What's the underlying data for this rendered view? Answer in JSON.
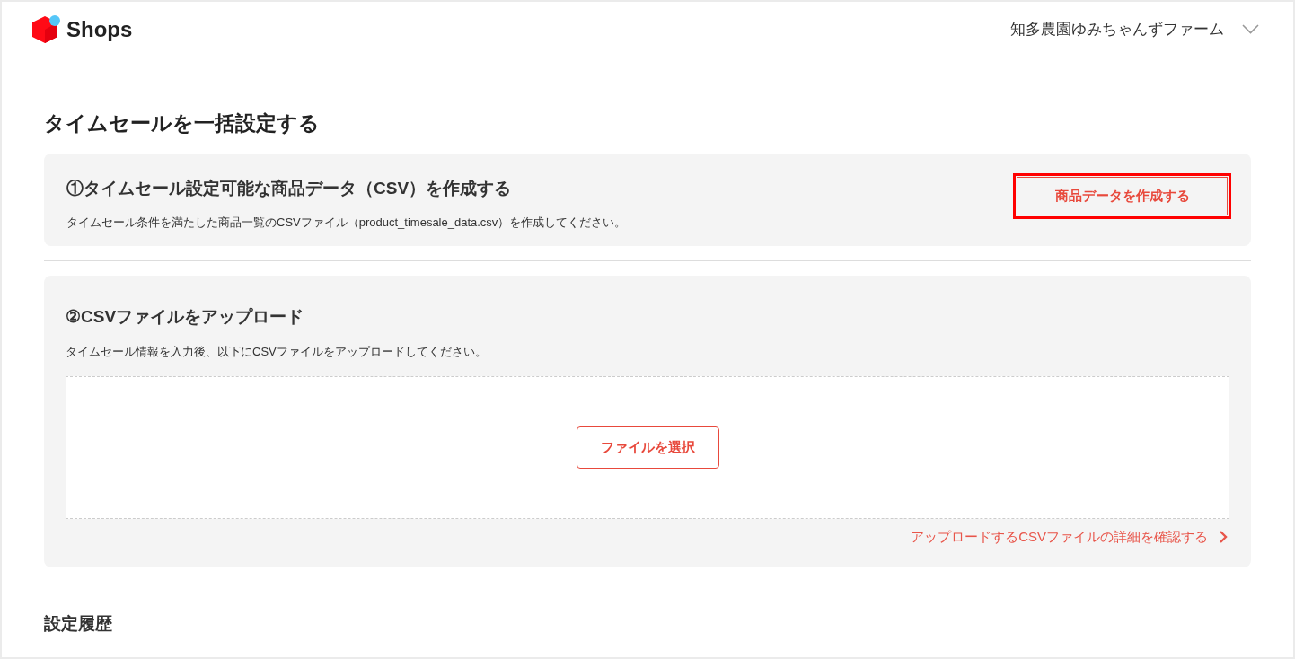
{
  "header": {
    "logo_text": "Shops",
    "shop_name": "知多農園ゆみちゃんずファーム"
  },
  "page_title": "タイムセールを一括設定する",
  "steps": [
    {
      "kind": "create",
      "title": "①タイムセール設定可能な商品データ（CSV）を作成する",
      "description": "タイムセール条件を満たした商品一覧のCSVファイル（product_timesale_data.csv）を作成してください。",
      "button": {
        "label": "商品データを作成する",
        "highlighted": true
      }
    },
    {
      "kind": "upload",
      "title": "②CSVファイルをアップロード",
      "description": "タイムセール情報を入力後、以下にCSVファイルをアップロードしてください。",
      "button": {
        "label": "ファイルを選択",
        "highlighted": false
      },
      "link": "アップロードするCSVファイルの詳細を確認する"
    }
  ],
  "history": {
    "title": "設定履歴"
  }
}
